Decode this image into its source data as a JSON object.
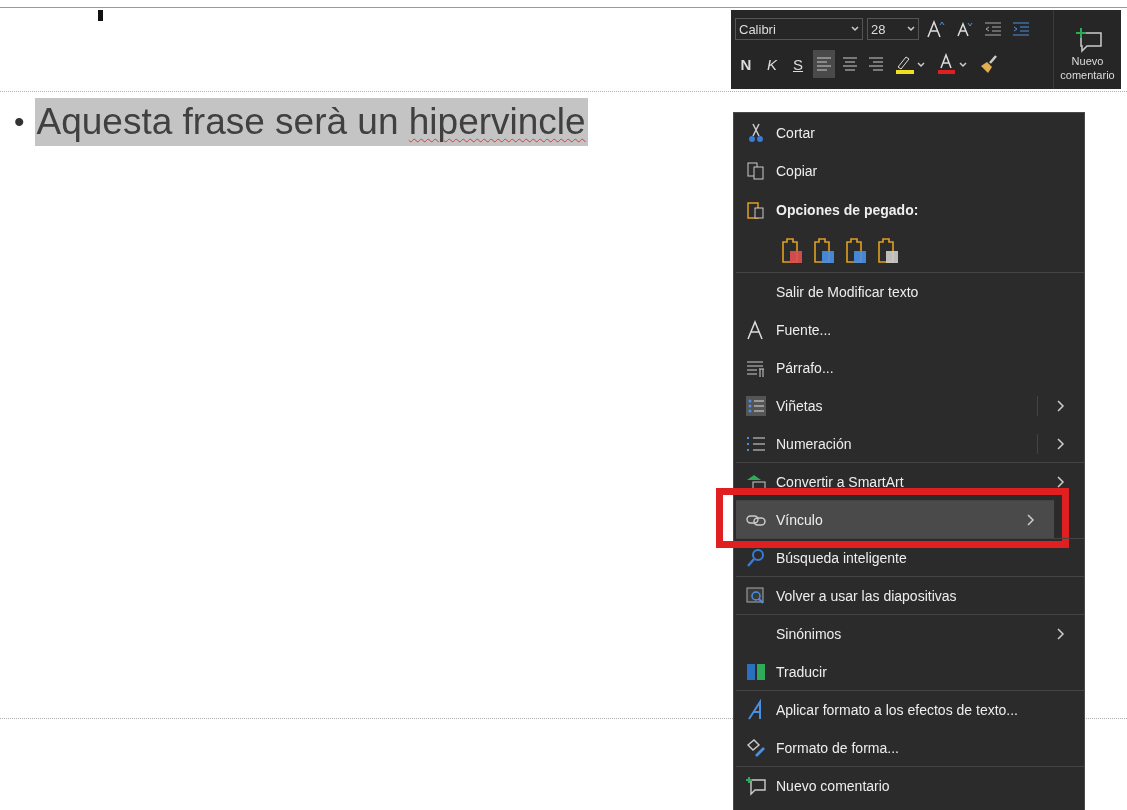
{
  "slide": {
    "bullet": "•",
    "segments": [
      {
        "text": "Aquesta frase serà un ",
        "misspelled": false
      },
      {
        "text": "hipervincle",
        "misspelled": true
      }
    ],
    "selected": true
  },
  "mini_toolbar": {
    "font": "Calibri",
    "size": "28",
    "format_buttons": [
      {
        "label": "N",
        "kind": "bold"
      },
      {
        "label": "K",
        "kind": "italic"
      },
      {
        "label": "S",
        "kind": "underline"
      }
    ],
    "align_buttons": [
      {
        "selected": true
      },
      {
        "selected": false
      },
      {
        "selected": false
      }
    ],
    "new_comment": [
      "Nuevo",
      "comentario"
    ]
  },
  "context_menu": [
    {
      "label": "Cortar",
      "kind": "item",
      "separator_before": false,
      "submenu": false,
      "split": false,
      "selected": false,
      "annotated": false
    },
    {
      "label": "Copiar",
      "kind": "item",
      "separator_before": false,
      "submenu": false,
      "split": false,
      "selected": false,
      "annotated": false
    },
    {
      "label": "Opciones de pegado:",
      "kind": "header",
      "separator_before": false,
      "submenu": false,
      "split": false,
      "selected": false,
      "annotated": false
    },
    {
      "kind": "paste-options",
      "separator_before": false,
      "submenu": false,
      "split": false,
      "selected": false,
      "annotated": false
    },
    {
      "label": "Salir de Modificar texto",
      "kind": "item",
      "separator_before": true,
      "submenu": false,
      "split": false,
      "selected": false,
      "annotated": false
    },
    {
      "label": "Fuente...",
      "kind": "item",
      "separator_before": false,
      "submenu": false,
      "split": false,
      "selected": false,
      "annotated": false
    },
    {
      "label": "Párrafo...",
      "kind": "item",
      "separator_before": false,
      "submenu": false,
      "split": false,
      "selected": false,
      "annotated": false
    },
    {
      "label": "Viñetas",
      "kind": "item",
      "separator_before": false,
      "submenu": true,
      "split": true,
      "selected": false,
      "annotated": false
    },
    {
      "label": "Numeración",
      "kind": "item",
      "separator_before": false,
      "submenu": true,
      "split": true,
      "selected": false,
      "annotated": false
    },
    {
      "label": "Convertir a SmartArt",
      "kind": "item",
      "separator_before": true,
      "submenu": true,
      "split": false,
      "selected": false,
      "annotated": false
    },
    {
      "label": "Vínculo",
      "kind": "item",
      "separator_before": true,
      "submenu": true,
      "split": false,
      "selected": true,
      "annotated": true
    },
    {
      "label": "Búsqueda inteligente",
      "kind": "item",
      "separator_before": true,
      "submenu": false,
      "split": false,
      "selected": false,
      "annotated": false
    },
    {
      "label": "Volver a usar las diapositivas",
      "kind": "item",
      "separator_before": true,
      "submenu": false,
      "split": false,
      "selected": false,
      "annotated": false
    },
    {
      "label": "Sinónimos",
      "kind": "item",
      "separator_before": true,
      "submenu": true,
      "split": false,
      "selected": false,
      "annotated": false
    },
    {
      "label": "Traducir",
      "kind": "item",
      "separator_before": false,
      "submenu": false,
      "split": false,
      "selected": false,
      "annotated": false
    },
    {
      "label": "Aplicar formato a los efectos de texto...",
      "kind": "item",
      "separator_before": true,
      "submenu": false,
      "split": false,
      "selected": false,
      "annotated": false
    },
    {
      "label": "Formato de forma...",
      "kind": "item",
      "separator_before": false,
      "submenu": false,
      "split": false,
      "selected": false,
      "annotated": false
    },
    {
      "label": "Nuevo comentario",
      "kind": "item",
      "separator_before": true,
      "submenu": false,
      "split": false,
      "selected": false,
      "annotated": false
    }
  ]
}
